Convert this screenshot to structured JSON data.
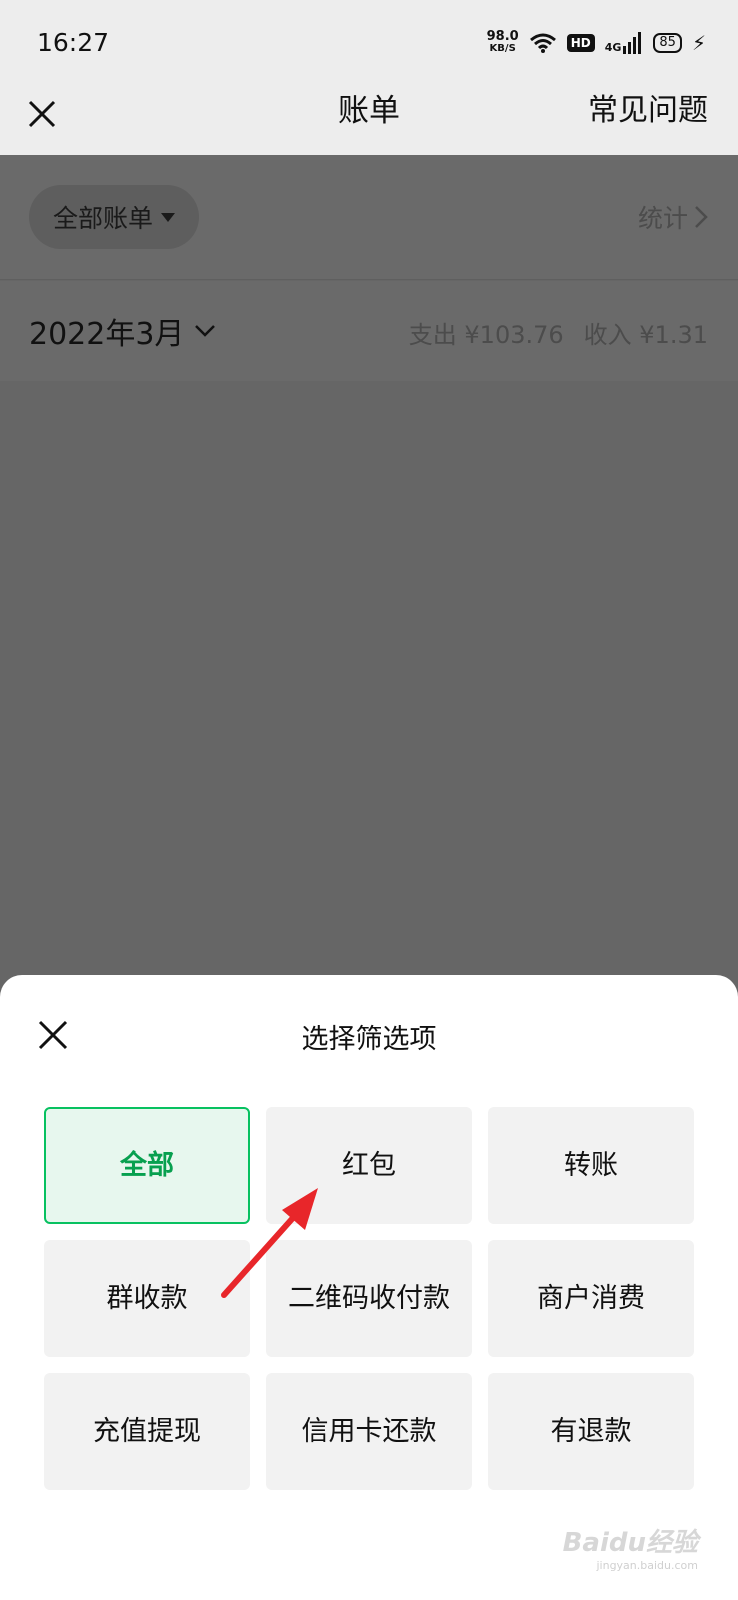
{
  "status_bar": {
    "time": "16:27",
    "speed_value": "98.0",
    "speed_unit": "KB/S",
    "hd": "HD",
    "network": "4G",
    "battery": "85"
  },
  "navbar": {
    "title": "账单",
    "faq": "常见问题"
  },
  "filter": {
    "all_bills": "全部账单",
    "stats": "统计"
  },
  "month": {
    "label": "2022年3月",
    "expense": "支出 ¥103.76",
    "income": "收入 ¥1.31"
  },
  "sheet": {
    "title": "选择筛选项",
    "options": [
      {
        "label": "全部",
        "selected": true
      },
      {
        "label": "红包",
        "selected": false
      },
      {
        "label": "转账",
        "selected": false
      },
      {
        "label": "群收款",
        "selected": false
      },
      {
        "label": "二维码收付款",
        "selected": false
      },
      {
        "label": "商户消费",
        "selected": false
      },
      {
        "label": "充值提现",
        "selected": false
      },
      {
        "label": "信用卡还款",
        "selected": false
      },
      {
        "label": "有退款",
        "selected": false
      }
    ]
  },
  "colors": {
    "accent": "#07c160",
    "annotation_arrow": "#e8262a"
  },
  "watermark": {
    "brand": "Baidu经验",
    "url": "jingyan.baidu.com"
  }
}
